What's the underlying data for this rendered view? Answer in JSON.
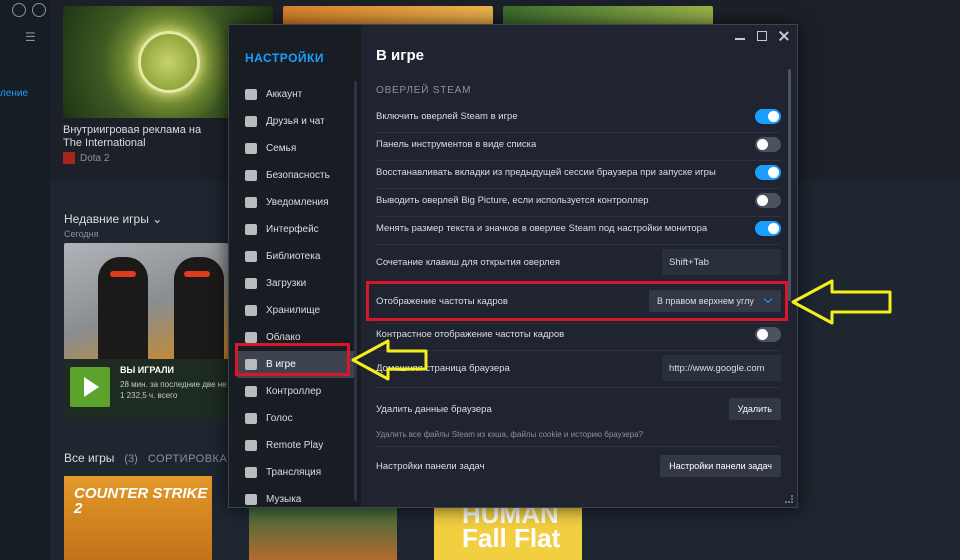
{
  "library": {
    "sidebar_link": "ление",
    "shelf_game_title": "Внутриигровая реклама на The International",
    "shelf_game_name": "Dota 2",
    "recent": {
      "heading": "Недавние игры",
      "subheading": "Сегодня",
      "card_status": "ВЫ ИГРАЛИ",
      "card_line1": "28 мин. за последние две не",
      "card_line2": "1 232,5 ч. всего"
    },
    "all_games": {
      "label": "Все игры",
      "count": "(3)",
      "sort": "СОРТИРОВКА"
    },
    "tile_cs_text": "COUNTER STRIKE 2",
    "tile_hff_text": "HUMAN Fall Flat"
  },
  "settings": {
    "sidebar_title": "НАСТРОЙКИ",
    "nav": [
      {
        "label": "Аккаунт",
        "icon": "account-icon"
      },
      {
        "label": "Друзья и чат",
        "icon": "friends-icon"
      },
      {
        "label": "Семья",
        "icon": "family-icon"
      },
      {
        "label": "Безопасность",
        "icon": "shield-icon"
      },
      {
        "label": "Уведомления",
        "icon": "notifications-icon"
      },
      {
        "label": "Интерфейс",
        "icon": "monitor-icon"
      },
      {
        "label": "Библиотека",
        "icon": "library-icon"
      },
      {
        "label": "Загрузки",
        "icon": "download-icon"
      },
      {
        "label": "Хранилище",
        "icon": "storage-icon"
      },
      {
        "label": "Облако",
        "icon": "cloud-icon"
      },
      {
        "label": "В игре",
        "icon": "in-game-icon"
      },
      {
        "label": "Контроллер",
        "icon": "controller-icon"
      },
      {
        "label": "Голос",
        "icon": "microphone-icon"
      },
      {
        "label": "Remote Play",
        "icon": "remote-play-icon"
      },
      {
        "label": "Трансляция",
        "icon": "broadcast-icon"
      },
      {
        "label": "Музыка",
        "icon": "music-icon"
      }
    ],
    "active_nav": "В игре",
    "page_title": "В игре",
    "section_title": "ОВЕРЛЕЙ STEAM",
    "toggles": [
      {
        "label": "Включить оверлей Steam в игре",
        "on": true
      },
      {
        "label": "Панель инструментов в виде списка",
        "on": false
      },
      {
        "label": "Восстанавливать вкладки из предыдущей сессии браузера при запуске игры",
        "on": true
      },
      {
        "label": "Выводить оверлей Big Picture, если используется контроллер",
        "on": false
      },
      {
        "label": "Менять размер текста и значков в оверлее Steam под настройки монитора",
        "on": true
      }
    ],
    "hotkey": {
      "label": "Сочетание клавиш для открытия оверлея",
      "value": "Shift+Tab"
    },
    "fps_display": {
      "label": "Отображение частоты кадров",
      "value": "В правом верхнем углу"
    },
    "fps_contrast": {
      "label": "Контрастное отображение частоты кадров",
      "on": false
    },
    "homepage": {
      "label": "Домашняя страница браузера",
      "value": "http://www.google.com"
    },
    "delete_browser": {
      "label": "Удалить данные браузера",
      "button": "Удалить",
      "hint": "Удалить все файлы Steam из кэша, файлы cookie и историю браузера?"
    },
    "taskbar": {
      "label": "Настройки панели задач",
      "button": "Настройки панели задач"
    }
  },
  "colors": {
    "accent": "#1a9fff",
    "highlight_box": "#d8182a",
    "arrow": "#f5ef1e"
  }
}
